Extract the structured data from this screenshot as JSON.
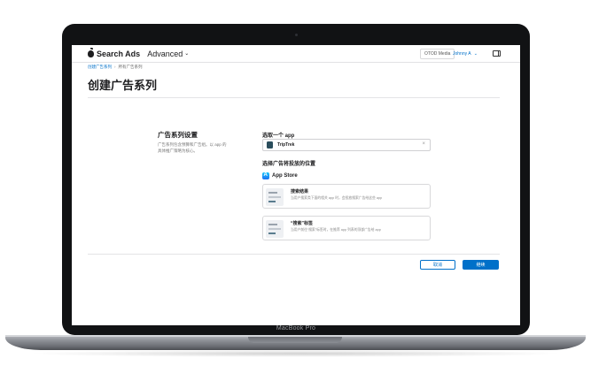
{
  "device": {
    "brand": "MacBook Pro"
  },
  "header": {
    "product": "Search Ads",
    "mode": "Advanced",
    "org": "OTOD Media",
    "user": "Johnny A"
  },
  "breadcrumb": {
    "parent": "创建广告系列",
    "current": "所有广告系列"
  },
  "page": {
    "title": "创建广告系列"
  },
  "settings": {
    "title": "广告系列设置",
    "description": "广告系列包含预算和广告组。以 app 的具体推广策略为核心。"
  },
  "app_select": {
    "label": "选取一个 app",
    "value": "TripTrek"
  },
  "placement": {
    "label": "选择广告将投放的位置",
    "store": "App Store",
    "options": [
      {
        "title": "搜索结果",
        "desc": "当用户搜索类下面的相关 app 时，会投放搜索广告给这些 app"
      },
      {
        "title": "“搜索”标签",
        "desc": "当用户前往“搜索”标签时，在推荐 app 列表的顶部广告给 app"
      }
    ]
  },
  "actions": {
    "cancel": "取消",
    "continue": "继续"
  },
  "colors": {
    "accent": "#0070c9",
    "bezel": "#111214"
  }
}
